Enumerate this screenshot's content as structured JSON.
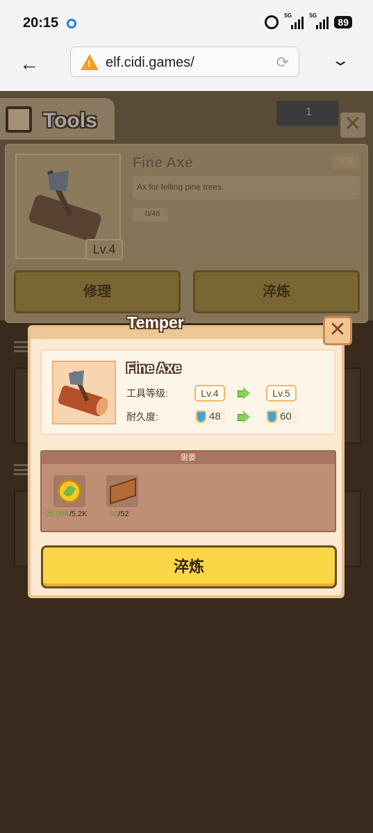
{
  "status_bar": {
    "time": "20:15",
    "signal1": "5G",
    "signal2": "5G",
    "battery": "89"
  },
  "browser": {
    "url": "elf.cidi.games/"
  },
  "background": {
    "tab_title": "Tools",
    "level_partial": "1",
    "item_name": "Fine Axe",
    "item_tag": "斧头",
    "item_desc": "Ax for felling pine trees.",
    "durability": "0/48",
    "item_level": "Lv.4",
    "buttons": [
      "修理",
      "淬炼"
    ]
  },
  "popup": {
    "title": "Temper",
    "item_name": "Fine Axe",
    "level_label": "工具等级:",
    "level_from": "Lv.4",
    "level_to": "Lv.5",
    "durability_label": "耐久度:",
    "durability_from": "48",
    "durability_to": "60",
    "requirements_label": "需要",
    "requirements": [
      {
        "icon": "coin-icon",
        "have": "25.59K",
        "need": "/5.2K"
      },
      {
        "icon": "wood-plank-icon",
        "have": "53",
        "need": "/52"
      }
    ],
    "temper_button": "淬炼"
  },
  "colors": {
    "accent": "#fbd647",
    "panel": "#fbe9d1",
    "ok": "#5ea024"
  }
}
